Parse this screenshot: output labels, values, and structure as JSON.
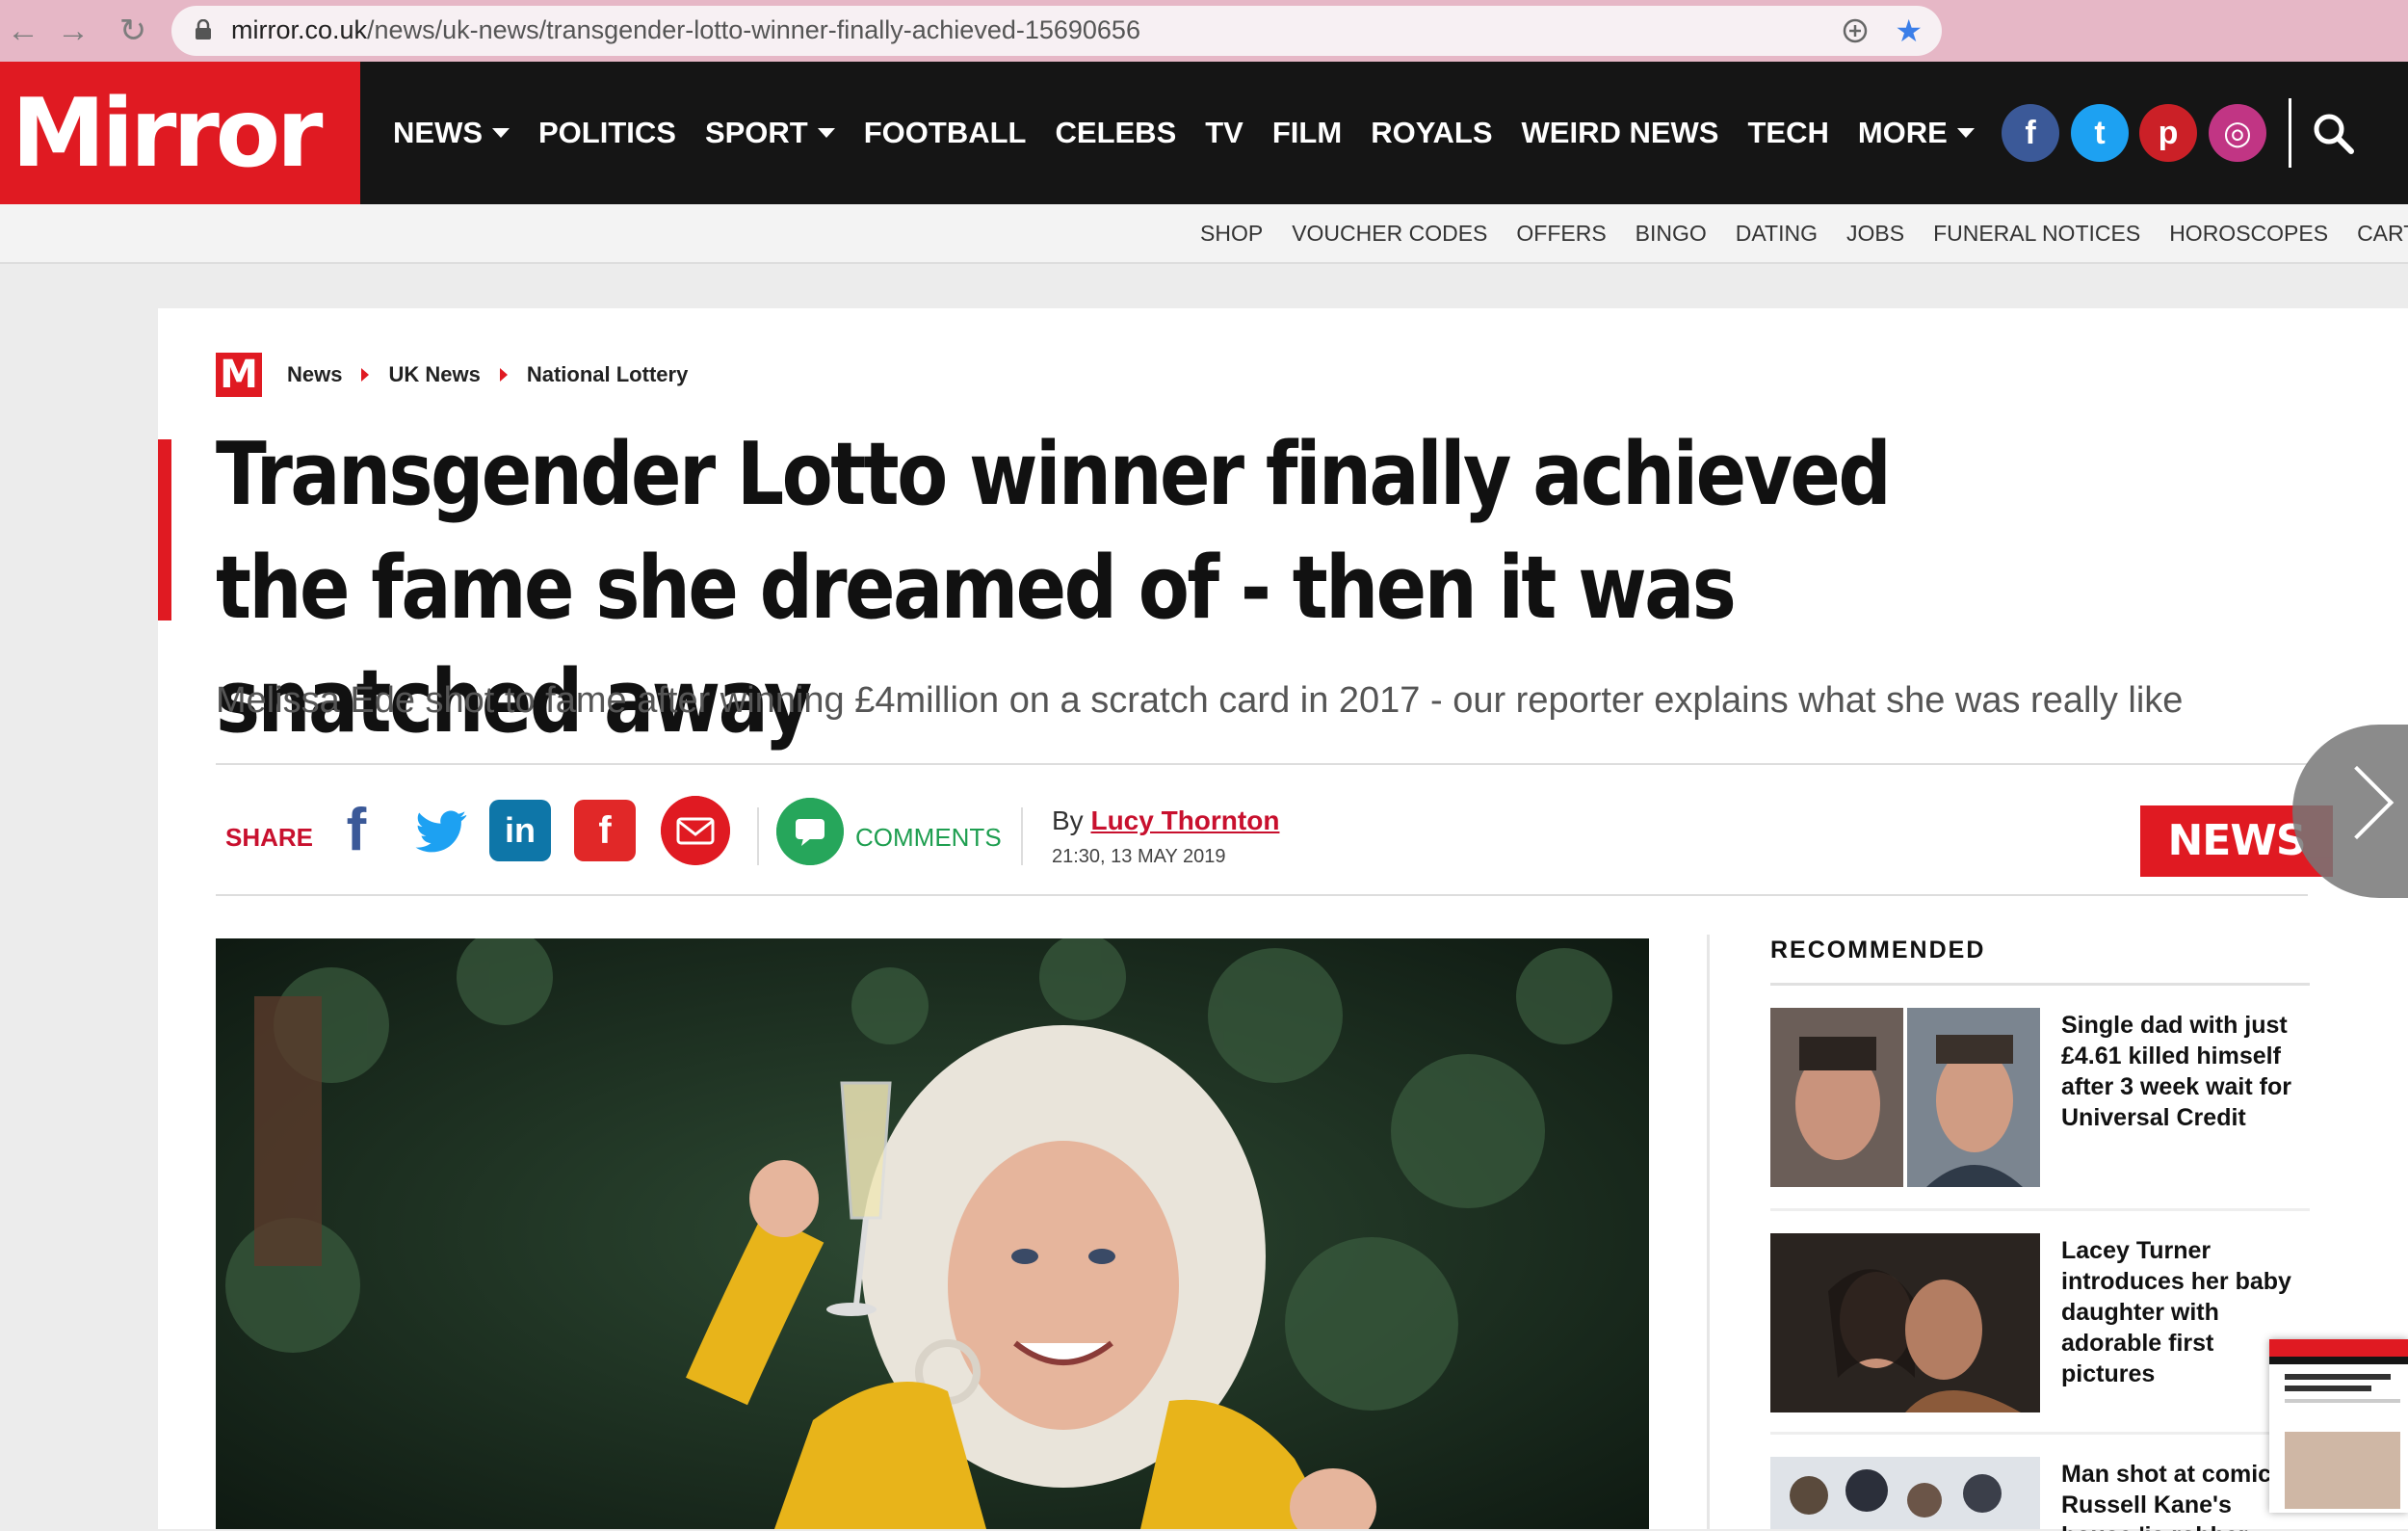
{
  "browser": {
    "url_host": "mirror.co.uk",
    "url_path": "/news/uk-news/transgender-lotto-winner-finally-achieved-15690656",
    "back_icon": "←",
    "forward_icon": "→",
    "reload_icon": "↻",
    "star_icon": "★"
  },
  "site": {
    "logo": "Mirror",
    "logo_m": "M",
    "nav": [
      "NEWS",
      "POLITICS",
      "SPORT",
      "FOOTBALL",
      "CELEBS",
      "TV",
      "FILM",
      "ROYALS",
      "WEIRD NEWS",
      "TECH",
      "MORE"
    ],
    "social": {
      "facebook": "f",
      "twitter": "t",
      "pinterest": "p",
      "instagram": "◎"
    },
    "subnav": [
      "SHOP",
      "VOUCHER CODES",
      "OFFERS",
      "BINGO",
      "DATING",
      "JOBS",
      "FUNERAL NOTICES",
      "HOROSCOPES",
      "CARTOONS"
    ],
    "accent": "#e01a22"
  },
  "article": {
    "breadcrumb": [
      "News",
      "UK News",
      "National Lottery"
    ],
    "headline": "Transgender Lotto winner finally achieved the fame she dreamed of - then it was snatched away",
    "standfirst": "Melissa Ede shot to fame after winning £4million on a scratch card in 2017 - our reporter explains what she was really like",
    "share_label": "SHARE",
    "share": {
      "facebook": "f",
      "linkedin": "in",
      "flipboard": "f"
    },
    "comments_label": "COMMENTS",
    "by_prefix": "By",
    "author": "Lucy Thornton",
    "date": "21:30, 13 MAY 2019",
    "section_badge": "NEWS"
  },
  "recommended": {
    "title": "RECOMMENDED",
    "items": [
      {
        "headline": "Single dad with just £4.61 killed himself after 3 week wait for Universal Credit"
      },
      {
        "headline": "Lacey Turner introduces her baby daughter with adorable first pictures"
      },
      {
        "headline": "Man shot at comic Russell Kane's house 'is robber"
      }
    ]
  }
}
